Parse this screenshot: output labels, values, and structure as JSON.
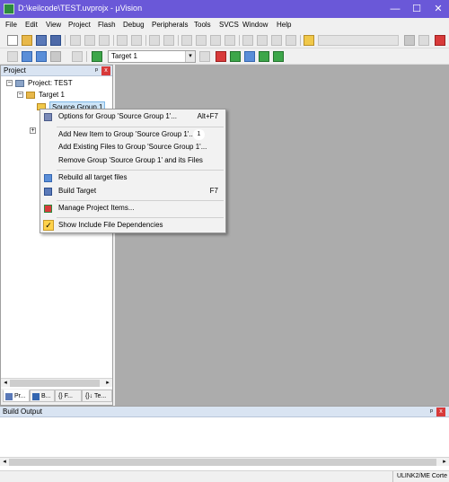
{
  "window": {
    "title": "D:\\keilcode\\TEST.uvprojx - µVision",
    "minimize_glyph": "—",
    "maximize_glyph": "☐",
    "close_glyph": "✕"
  },
  "menu": [
    "File",
    "Edit",
    "View",
    "Project",
    "Flash",
    "Debug",
    "Peripherals",
    "Tools",
    "SVCS",
    "Window",
    "Help"
  ],
  "toolbar2": {
    "target_select_value": "Target 1",
    "dropdown_arrow": "▾"
  },
  "project_pane": {
    "title": "Project",
    "pin_glyph": "ᵖ",
    "close_glyph": "x",
    "tree": {
      "root_label": "Project: TEST",
      "target_label": "Target 1",
      "group_label": "Source Group 1"
    },
    "tabs": [
      "Pr...",
      "B...",
      "{} F...",
      "{}↓ Te..."
    ],
    "scroll_left": "◂",
    "scroll_right": "▸"
  },
  "context_menu": {
    "items": [
      {
        "label": "Options for Group 'Source Group 1'...",
        "shortcut": "Alt+F7",
        "icon": "options-wand-icon"
      },
      {
        "label": "Add New  Item to Group 'Source Group 1'...",
        "shortcut": "",
        "badge": "1",
        "icon": ""
      },
      {
        "label": "Add Existing Files to Group 'Source Group 1'...",
        "shortcut": "",
        "icon": ""
      },
      {
        "label": "Remove Group 'Source Group 1' and its Files",
        "shortcut": "",
        "icon": ""
      },
      {
        "label": "Rebuild all target files",
        "shortcut": "",
        "icon": "rebuild-icon"
      },
      {
        "label": "Build Target",
        "shortcut": "F7",
        "icon": "build-icon"
      },
      {
        "label": "Manage Project Items...",
        "shortcut": "",
        "icon": "manage-items-icon"
      },
      {
        "label": "Show Include File Dependencies",
        "shortcut": "",
        "icon": "checkmark-icon",
        "checked": true
      }
    ]
  },
  "build_output": {
    "title": "Build Output",
    "pin_glyph": "ᵖ",
    "close_glyph": "x",
    "scroll_left": "◂",
    "scroll_right": "▸"
  },
  "statusbar": {
    "debugger": "ULINK2/ME Corte"
  },
  "colors": {
    "titlebar": "#6a58d8",
    "editor_bg": "#acacac",
    "pane_header": "#d9e4f2",
    "check_highlight": "#ffd24a"
  }
}
